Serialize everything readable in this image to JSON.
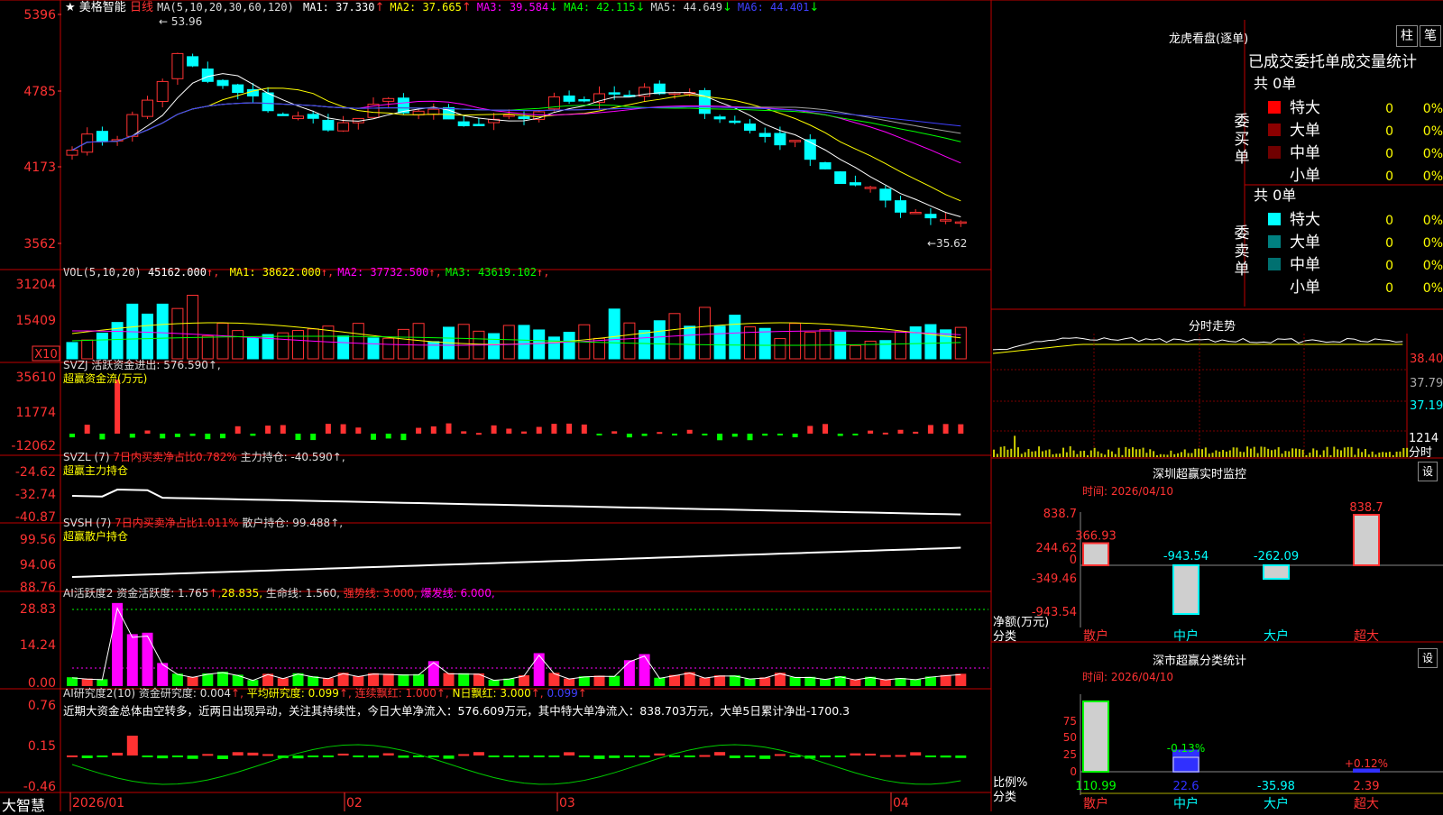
{
  "stock": {
    "name": "美格智能",
    "period": "日线",
    "star": "★"
  },
  "colors": {
    "up": "#ff3232",
    "down": "#00ffff",
    "border": "#c00000",
    "grid": "#7a0000",
    "ma1": "#ffffff",
    "ma2": "#ffff00",
    "ma3": "#ff00ff",
    "ma4": "#00ff00",
    "ma5": "#a0a0a0",
    "ma6": "#4040ff"
  },
  "kline": {
    "header": {
      "prefix": "MA(5,10,20,30,60,120)",
      "items": [
        {
          "label": "MA1:",
          "value": "37.330",
          "arrow": "↑",
          "color": "#ffffff"
        },
        {
          "label": "MA2:",
          "value": "37.665",
          "arrow": "↑",
          "color": "#ffff00"
        },
        {
          "label": "MA3:",
          "value": "39.584",
          "arrow": "↓",
          "color": "#ff00ff"
        },
        {
          "label": "MA4:",
          "value": "42.115",
          "arrow": "↓",
          "color": "#00ff00"
        },
        {
          "label": "MA5:",
          "value": "44.649",
          "arrow": "↓",
          "color": "#d0d0d0"
        },
        {
          "label": "MA6:",
          "value": "44.401",
          "arrow": "↓",
          "color": "#4040ff"
        }
      ]
    },
    "yticks": [
      "5396",
      "4785",
      "4173",
      "3562"
    ],
    "hi_label": "53.96",
    "lo_label": "35.62"
  },
  "vol": {
    "header": {
      "prefix": "VOL(5,10,20)",
      "value": "45162.000",
      "items": [
        {
          "label": "MA1:",
          "value": "38622.000",
          "color": "#ffff00"
        },
        {
          "label": "MA2:",
          "value": "37732.500",
          "color": "#ff00ff"
        },
        {
          "label": "MA3:",
          "value": "43619.102",
          "color": "#00ff00"
        }
      ]
    },
    "yticks": [
      "31204",
      "15409"
    ],
    "unit": "X10"
  },
  "svzj": {
    "line1": "SVZJ  活跃资金进出: 576.590↑,",
    "line2": "超赢资金流(万元)",
    "yticks": [
      "35610",
      "11774",
      "-12062"
    ]
  },
  "svzl": {
    "prefix": "SVZL (7)",
    "red": "7日内买卖净占比0.782%",
    "rest": "主力持仓: -40.590↑,",
    "line2": "超赢主力持仓",
    "yticks": [
      "-24.62",
      "-32.74",
      "-40.87"
    ]
  },
  "svsh": {
    "prefix": "SVSH (7)",
    "red": "7日内买卖净占比1.011%",
    "rest": "散户持仓: 99.488↑,",
    "line2": "超赢散户持仓",
    "yticks": [
      "99.56",
      "94.06",
      "88.76"
    ]
  },
  "ai2": {
    "parts": [
      {
        "t": "AI活跃度2 资金活跃度: 1.765",
        "c": "#dddddd"
      },
      {
        "t": "↑,",
        "c": "#ff3232"
      },
      {
        "t": "28.835,",
        "c": "#ffff00"
      },
      {
        "t": " 生命线: 1.560,",
        "c": "#dddddd"
      },
      {
        "t": " 强势线: 3.000,",
        "c": "#ff3232"
      },
      {
        "t": " 爆发线: 6.000,",
        "c": "#ff00ff"
      }
    ],
    "yticks": [
      "28.83",
      "14.24",
      "0.00"
    ]
  },
  "research": {
    "parts": [
      {
        "t": "AI研究度2(10) 资金研究度: 0.004",
        "c": "#dddddd"
      },
      {
        "t": "↑, ",
        "c": "#ff3232"
      },
      {
        "t": "平均研究度: 0.099",
        "c": "#ffff00"
      },
      {
        "t": "↑, ",
        "c": "#ff3232"
      },
      {
        "t": "连续飘红: 1.000",
        "c": "#ff3232"
      },
      {
        "t": "↑, ",
        "c": "#ff3232"
      },
      {
        "t": "N日飘红: 3.000",
        "c": "#ffff00"
      },
      {
        "t": "↑, ",
        "c": "#ff3232"
      },
      {
        "t": "0.099",
        "c": "#4040ff"
      },
      {
        "t": "↑",
        "c": "#ff3232"
      }
    ],
    "text": "近期大资金总体由空转多，近两日出现异动，关注其持续性，今日大单净流入：576.609万元，其中特大单净流入：838.703万元，大单5日累计净出-1700.3",
    "yticks": [
      "0.76",
      "0.15",
      "-0.46"
    ]
  },
  "xaxis": {
    "labels": [
      "2026/01",
      "02",
      "03",
      "04"
    ]
  },
  "brand": "大智慧",
  "longhu": {
    "title": "龙虎看盘(逐单)",
    "btn1": "柱",
    "btn2": "笔",
    "subtitle": "已成交委托单成交量统计",
    "buy": {
      "side": "委买单",
      "total": "共 0单",
      "rows": [
        {
          "label": "特大",
          "val": "0",
          "pct": "0%",
          "color": "#ff0000"
        },
        {
          "label": "大单",
          "val": "0",
          "pct": "0%",
          "color": "#8b0000"
        },
        {
          "label": "中单",
          "val": "0",
          "pct": "0%",
          "color": "#700000"
        },
        {
          "label": "小单",
          "val": "0",
          "pct": "0%",
          "color": "#000000"
        }
      ]
    },
    "sell": {
      "side": "委卖单",
      "total": "共 0单",
      "rows": [
        {
          "label": "特大",
          "val": "0",
          "pct": "0%",
          "color": "#00ffff"
        },
        {
          "label": "大单",
          "val": "0",
          "pct": "0%",
          "color": "#008080"
        },
        {
          "label": "中单",
          "val": "0",
          "pct": "0%",
          "color": "#007070"
        },
        {
          "label": "小单",
          "val": "0",
          "pct": "0%",
          "color": "#000000"
        }
      ]
    }
  },
  "intraday": {
    "title": "分时走势",
    "prices": [
      "38.40",
      "37.79",
      "37.19"
    ],
    "vol_label": "1214",
    "unit": "分时"
  },
  "monitor": {
    "title": "深圳超赢实时监控",
    "btn": "设",
    "time": "时间: 2026/04/10",
    "yticks": [
      "838.7",
      "244.62",
      "0",
      "-349.46",
      "-943.54"
    ],
    "ylabel": "净额(万元)",
    "xlabel": "分类",
    "chart_data": {
      "type": "bar",
      "categories": [
        "散户",
        "中户",
        "大户",
        "超大"
      ],
      "values": [
        366.93,
        -943.54,
        -262.09,
        838.7
      ],
      "labels": [
        "366.93",
        "-943.54",
        "-262.09",
        "838.7"
      ],
      "ylim": [
        -943.54,
        838.7
      ]
    }
  },
  "classify": {
    "title": "深市超赢分类统计",
    "btn": "设",
    "time": "时间: 2026/04/10",
    "yticks": [
      "75",
      "50",
      "25",
      "0"
    ],
    "ylabel": "比例%",
    "xlabel": "分类",
    "chart_data": {
      "type": "bar",
      "categories": [
        "散户",
        "中户",
        "大户",
        "超大"
      ],
      "values": [
        110.99,
        22.6,
        -35.98,
        2.39
      ],
      "bar_pct": [
        "",
        "-0.13%",
        "",
        "+0.12%"
      ],
      "ylim": [
        0,
        75
      ]
    }
  }
}
